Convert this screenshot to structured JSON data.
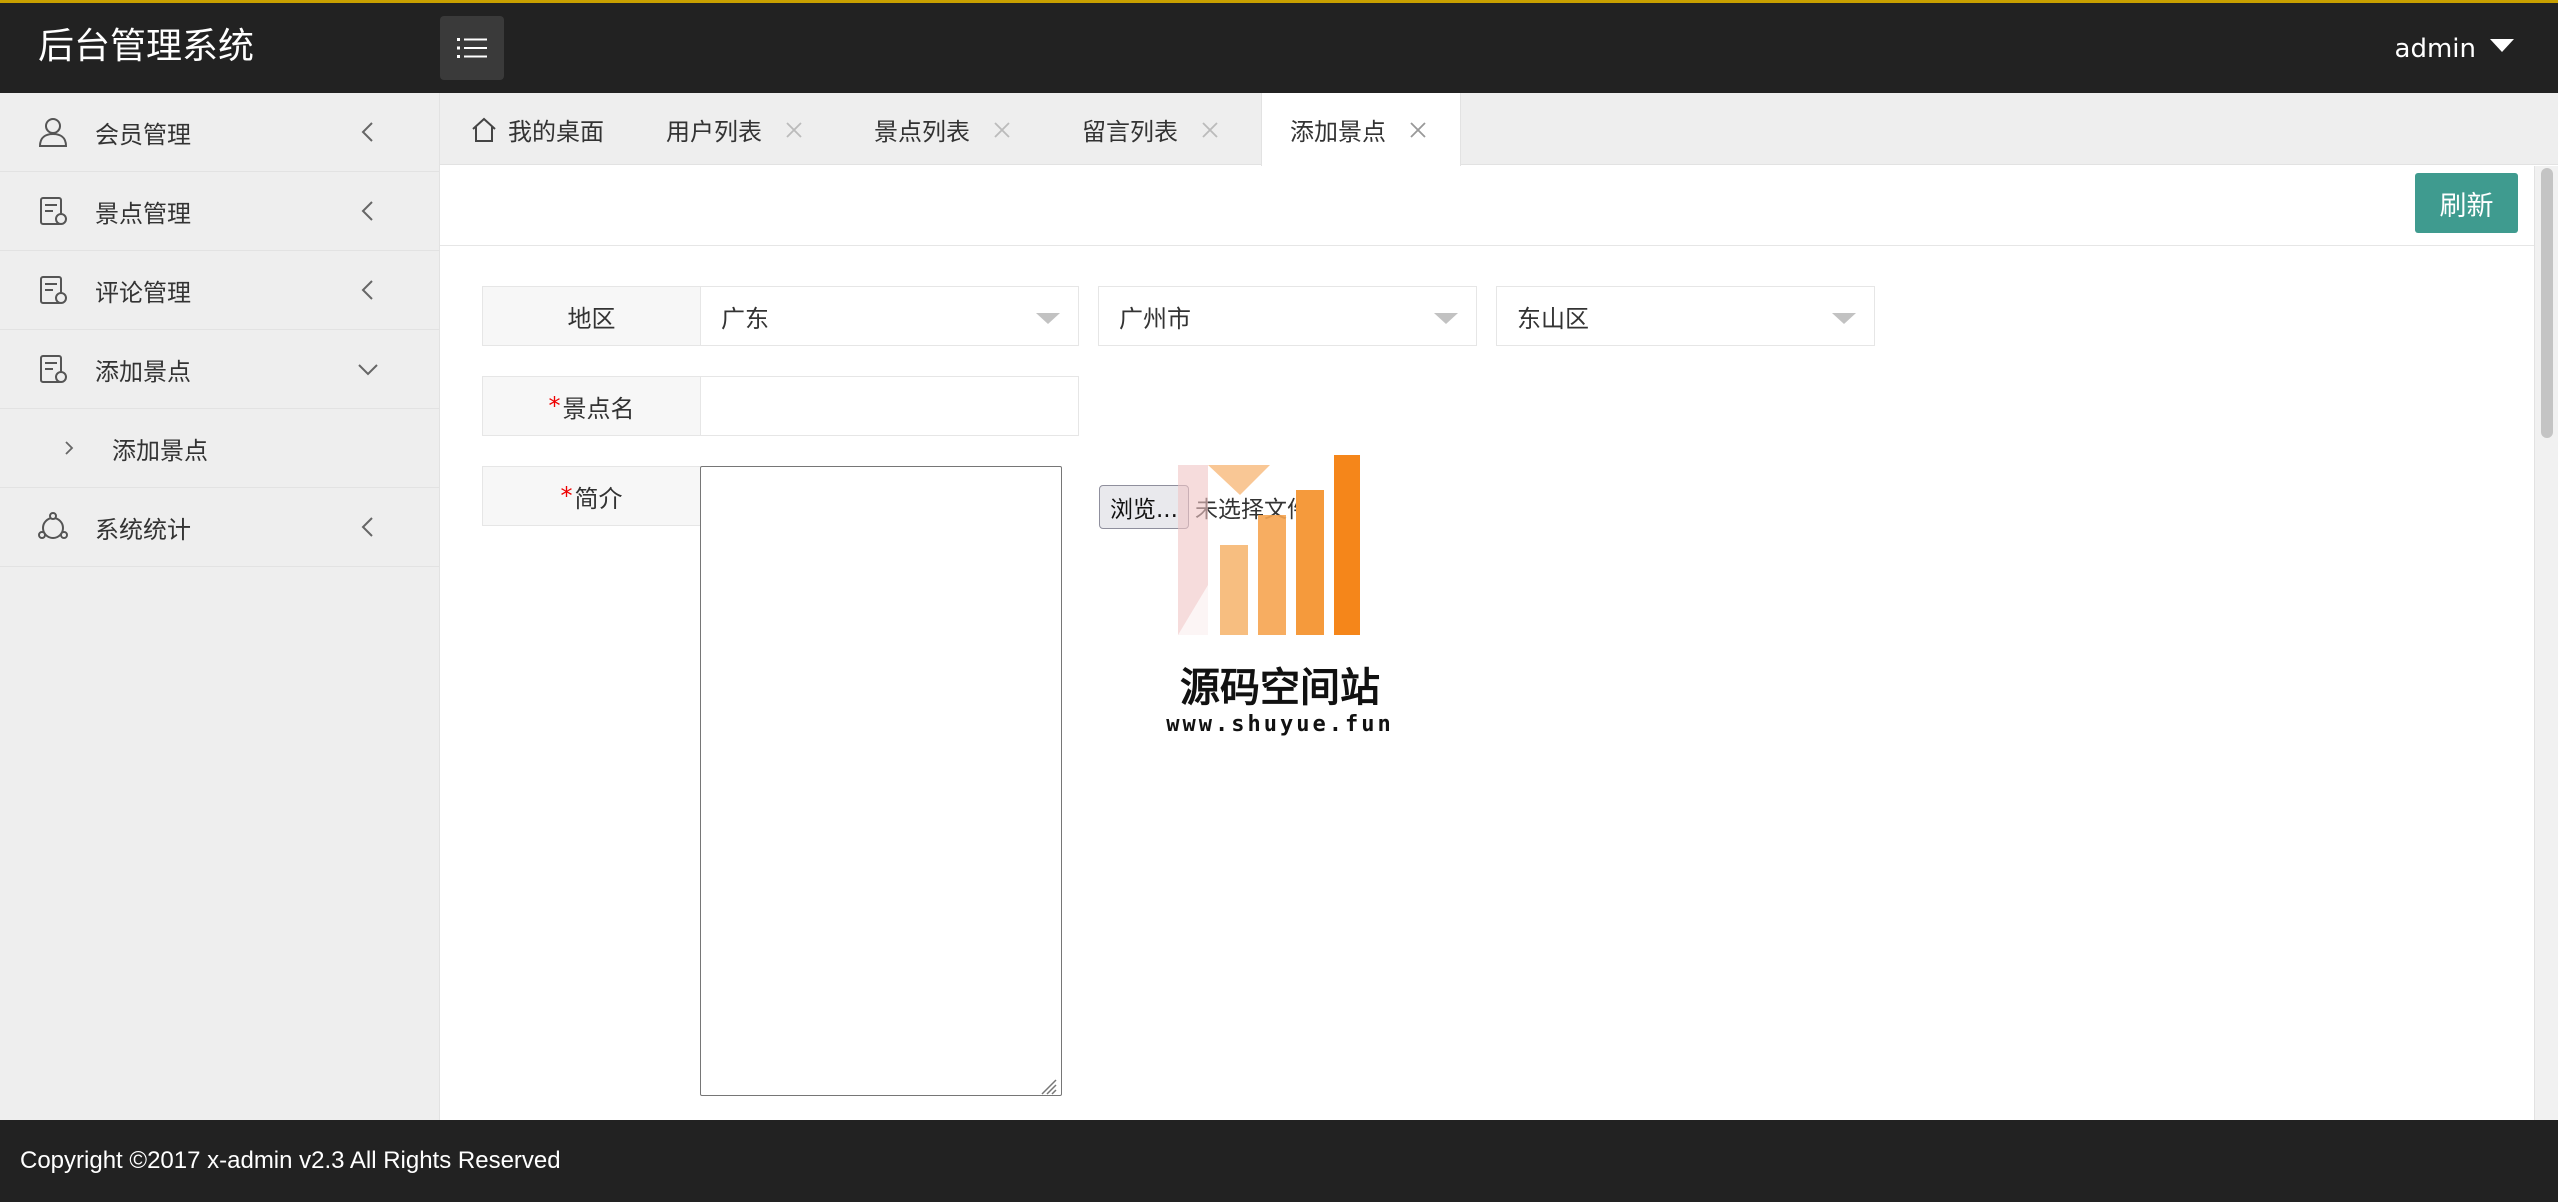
{
  "app": {
    "title": "后台管理系统",
    "user": "admin"
  },
  "sidebar": {
    "items": [
      {
        "label": "会员管理",
        "icon": "user-icon"
      },
      {
        "label": "景点管理",
        "icon": "doc-icon"
      },
      {
        "label": "评论管理",
        "icon": "doc-icon"
      },
      {
        "label": "添加景点",
        "icon": "doc-icon",
        "expanded": true,
        "children": [
          {
            "label": "添加景点"
          }
        ]
      },
      {
        "label": "系统统计",
        "icon": "stats-icon"
      }
    ]
  },
  "tabs": [
    {
      "label": "我的桌面",
      "icon": "home-icon",
      "closable": false
    },
    {
      "label": "用户列表",
      "closable": true
    },
    {
      "label": "景点列表",
      "closable": true
    },
    {
      "label": "留言列表",
      "closable": true
    },
    {
      "label": "添加景点",
      "closable": true,
      "active": true
    }
  ],
  "toolbar": {
    "refresh_label": "刷新"
  },
  "form": {
    "region": {
      "label": "地区",
      "province": "广东",
      "city": "广州市",
      "district": "东山区"
    },
    "name": {
      "required_mark": "*",
      "label": "景点名",
      "value": ""
    },
    "intro": {
      "required_mark": "*",
      "label": "简介",
      "value": ""
    },
    "file": {
      "button_label": "浏览...",
      "status": "未选择文件。"
    }
  },
  "watermark": {
    "title": "源码空间站",
    "url": "www.shuyue.fun"
  },
  "footer": {
    "copyright": "Copyright ©2017 x-admin v2.3 All Rights Reserved"
  },
  "colors": {
    "header_bg": "#222222",
    "accent_top": "#c8a000",
    "refresh_btn": "#3f9b8f",
    "required": "#ee0000"
  }
}
